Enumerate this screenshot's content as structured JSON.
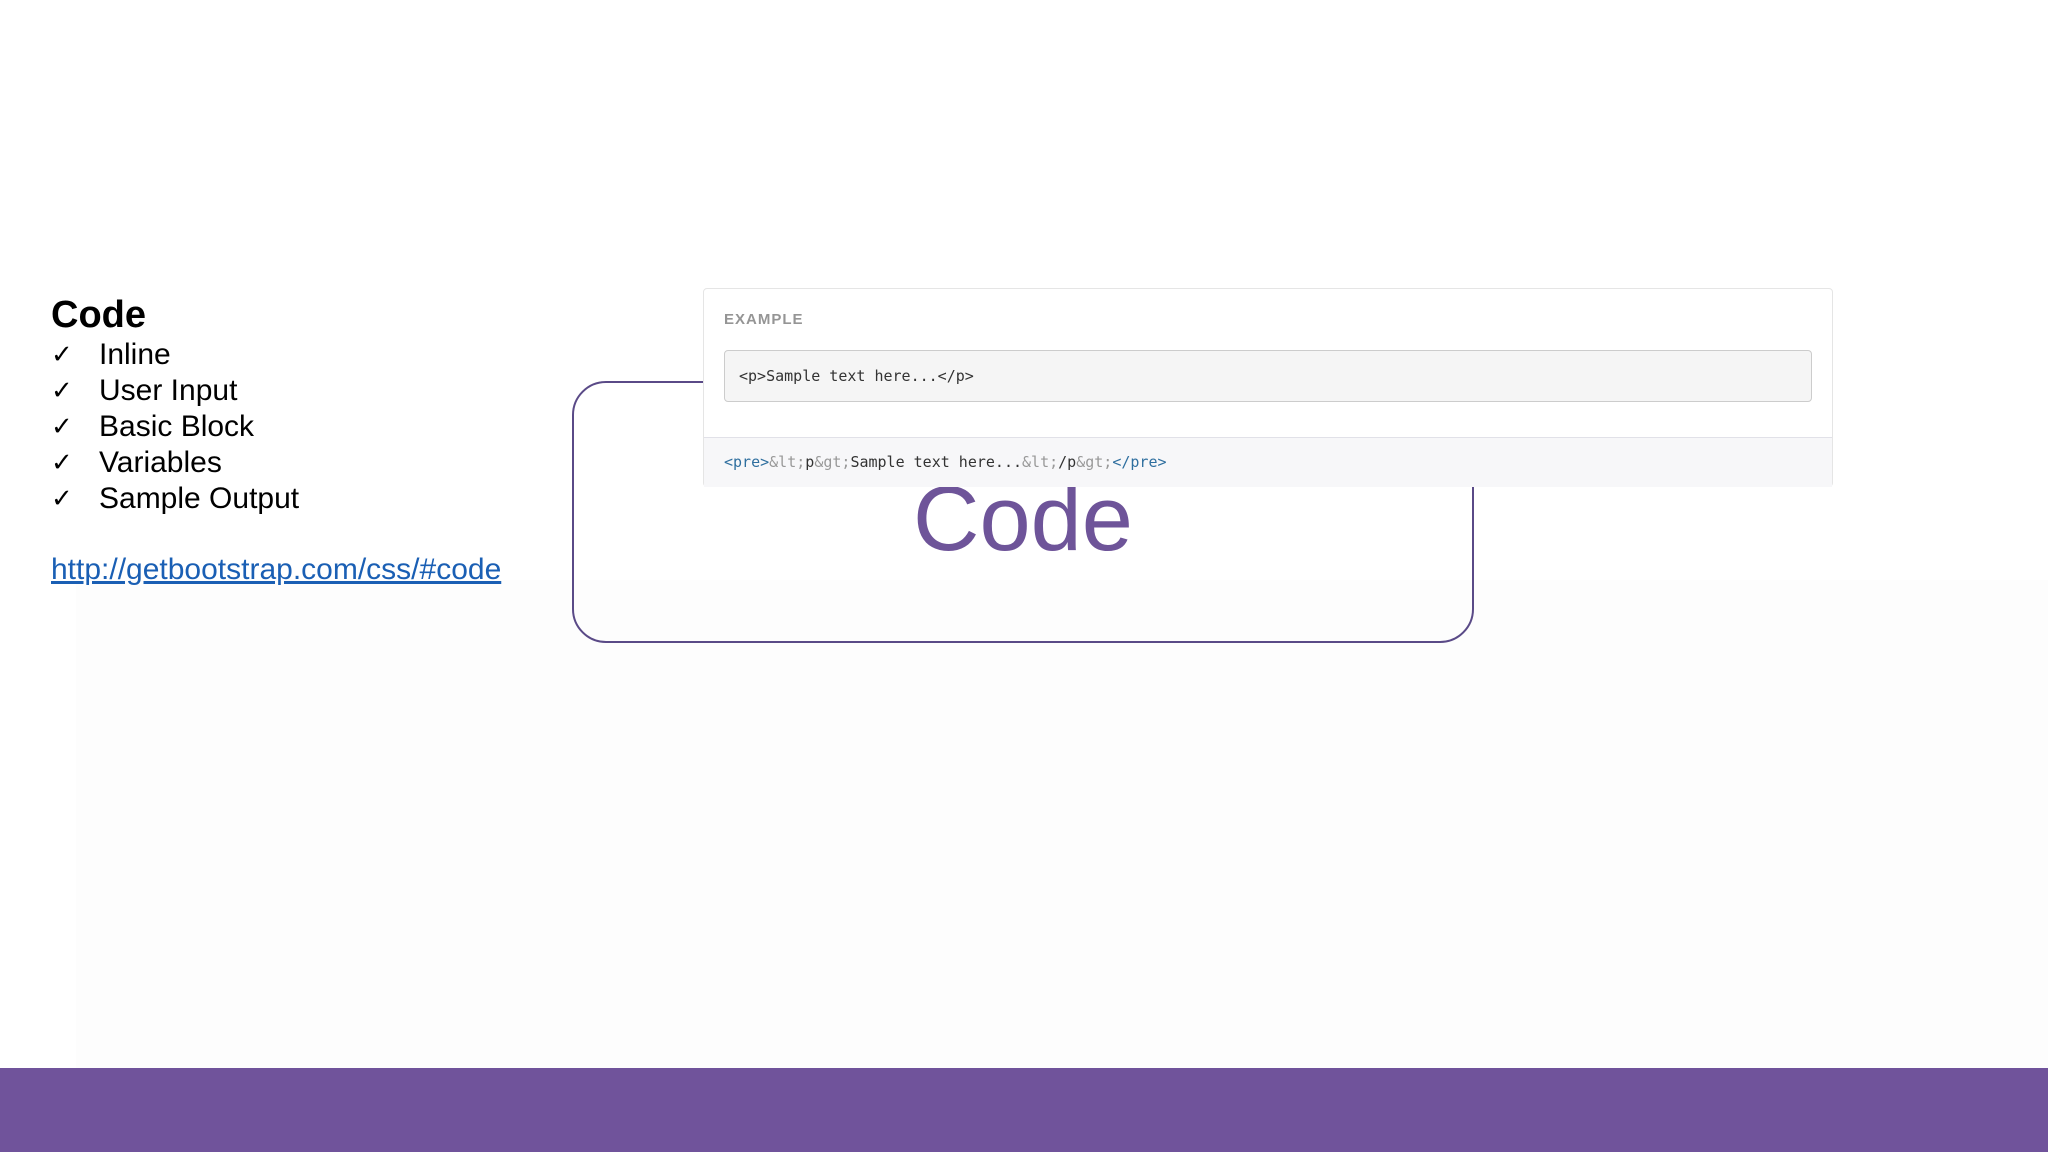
{
  "slide": {
    "heading": "Code",
    "checklist": [
      {
        "icon": "checkmark-icon",
        "glyph": "✓",
        "label": "Inline"
      },
      {
        "icon": "checkmark-icon",
        "glyph": "✓",
        "label": "User Input"
      },
      {
        "icon": "checkmark-icon",
        "glyph": "✓",
        "label": "Basic Block"
      },
      {
        "icon": "checkmark-icon",
        "glyph": "✓",
        "label": "Variables"
      },
      {
        "icon": "checkmark-icon",
        "glyph": "✓",
        "label": "Sample Output"
      }
    ],
    "link_text": "http://getbootstrap.com/css/#code",
    "big_title": "Code"
  },
  "example": {
    "label": "EXAMPLE",
    "rendered": "<p>Sample text here...</p>",
    "source": {
      "open_tag": "<pre>",
      "ent1": "&lt;",
      "txt1": "p",
      "ent2": "&gt;",
      "txt2": "Sample text here...",
      "ent3": "&lt;",
      "txt3": "/p",
      "ent4": "&gt;",
      "close_tag": "</pre>"
    }
  },
  "colors": {
    "accent": "#70539b",
    "title": "#6e5499",
    "link": "#1a5fb4",
    "frame": "#5a4a87"
  }
}
